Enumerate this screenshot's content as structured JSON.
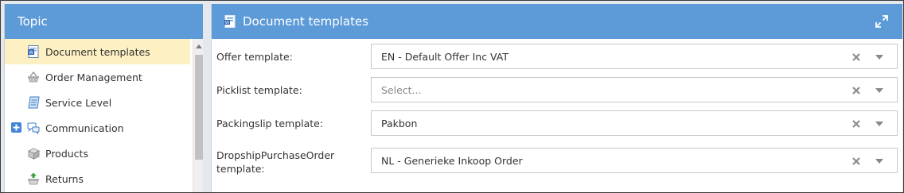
{
  "topic_panel": {
    "title": "Topic",
    "items": [
      {
        "label": "Document templates",
        "icon": "document-word-icon",
        "active": true
      },
      {
        "label": "Order Management",
        "icon": "basket-icon"
      },
      {
        "label": "Service Level",
        "icon": "notebook-icon"
      },
      {
        "label": "Communication",
        "icon": "chat-bubbles-icon",
        "expandable": true
      },
      {
        "label": "Products",
        "icon": "box-icon"
      },
      {
        "label": "Returns",
        "icon": "return-basket-icon"
      }
    ]
  },
  "doc_panel": {
    "title": "Document templates",
    "fields": [
      {
        "label": "Offer template:",
        "value": "EN - Default Offer Inc VAT"
      },
      {
        "label": "Picklist template:",
        "value": "Select..."
      },
      {
        "label": "Packingslip template:",
        "value": "Pakbon"
      },
      {
        "label_line1": "DropshipPurchaseOrder",
        "label_line2": "template:",
        "value": "NL - Generieke Inkoop Order"
      }
    ]
  },
  "colors": {
    "header": "#5d9ad8",
    "active_row": "#fdf0c2",
    "expand": "#3f86d6"
  }
}
